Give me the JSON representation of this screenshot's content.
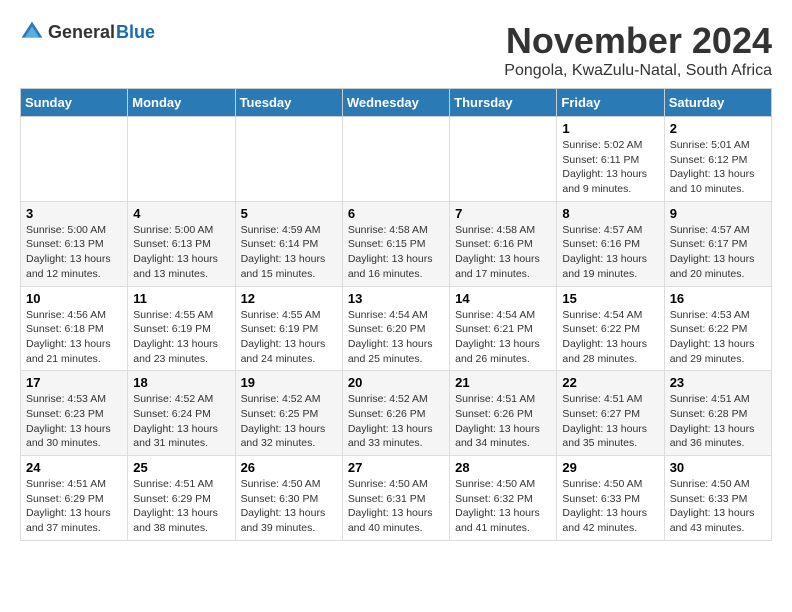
{
  "logo": {
    "general": "General",
    "blue": "Blue"
  },
  "title": "November 2024",
  "subtitle": "Pongola, KwaZulu-Natal, South Africa",
  "headers": [
    "Sunday",
    "Monday",
    "Tuesday",
    "Wednesday",
    "Thursday",
    "Friday",
    "Saturday"
  ],
  "rows": [
    [
      {
        "day": "",
        "detail": ""
      },
      {
        "day": "",
        "detail": ""
      },
      {
        "day": "",
        "detail": ""
      },
      {
        "day": "",
        "detail": ""
      },
      {
        "day": "",
        "detail": ""
      },
      {
        "day": "1",
        "detail": "Sunrise: 5:02 AM\nSunset: 6:11 PM\nDaylight: 13 hours\nand 9 minutes."
      },
      {
        "day": "2",
        "detail": "Sunrise: 5:01 AM\nSunset: 6:12 PM\nDaylight: 13 hours\nand 10 minutes."
      }
    ],
    [
      {
        "day": "3",
        "detail": "Sunrise: 5:00 AM\nSunset: 6:13 PM\nDaylight: 13 hours\nand 12 minutes."
      },
      {
        "day": "4",
        "detail": "Sunrise: 5:00 AM\nSunset: 6:13 PM\nDaylight: 13 hours\nand 13 minutes."
      },
      {
        "day": "5",
        "detail": "Sunrise: 4:59 AM\nSunset: 6:14 PM\nDaylight: 13 hours\nand 15 minutes."
      },
      {
        "day": "6",
        "detail": "Sunrise: 4:58 AM\nSunset: 6:15 PM\nDaylight: 13 hours\nand 16 minutes."
      },
      {
        "day": "7",
        "detail": "Sunrise: 4:58 AM\nSunset: 6:16 PM\nDaylight: 13 hours\nand 17 minutes."
      },
      {
        "day": "8",
        "detail": "Sunrise: 4:57 AM\nSunset: 6:16 PM\nDaylight: 13 hours\nand 19 minutes."
      },
      {
        "day": "9",
        "detail": "Sunrise: 4:57 AM\nSunset: 6:17 PM\nDaylight: 13 hours\nand 20 minutes."
      }
    ],
    [
      {
        "day": "10",
        "detail": "Sunrise: 4:56 AM\nSunset: 6:18 PM\nDaylight: 13 hours\nand 21 minutes."
      },
      {
        "day": "11",
        "detail": "Sunrise: 4:55 AM\nSunset: 6:19 PM\nDaylight: 13 hours\nand 23 minutes."
      },
      {
        "day": "12",
        "detail": "Sunrise: 4:55 AM\nSunset: 6:19 PM\nDaylight: 13 hours\nand 24 minutes."
      },
      {
        "day": "13",
        "detail": "Sunrise: 4:54 AM\nSunset: 6:20 PM\nDaylight: 13 hours\nand 25 minutes."
      },
      {
        "day": "14",
        "detail": "Sunrise: 4:54 AM\nSunset: 6:21 PM\nDaylight: 13 hours\nand 26 minutes."
      },
      {
        "day": "15",
        "detail": "Sunrise: 4:54 AM\nSunset: 6:22 PM\nDaylight: 13 hours\nand 28 minutes."
      },
      {
        "day": "16",
        "detail": "Sunrise: 4:53 AM\nSunset: 6:22 PM\nDaylight: 13 hours\nand 29 minutes."
      }
    ],
    [
      {
        "day": "17",
        "detail": "Sunrise: 4:53 AM\nSunset: 6:23 PM\nDaylight: 13 hours\nand 30 minutes."
      },
      {
        "day": "18",
        "detail": "Sunrise: 4:52 AM\nSunset: 6:24 PM\nDaylight: 13 hours\nand 31 minutes."
      },
      {
        "day": "19",
        "detail": "Sunrise: 4:52 AM\nSunset: 6:25 PM\nDaylight: 13 hours\nand 32 minutes."
      },
      {
        "day": "20",
        "detail": "Sunrise: 4:52 AM\nSunset: 6:26 PM\nDaylight: 13 hours\nand 33 minutes."
      },
      {
        "day": "21",
        "detail": "Sunrise: 4:51 AM\nSunset: 6:26 PM\nDaylight: 13 hours\nand 34 minutes."
      },
      {
        "day": "22",
        "detail": "Sunrise: 4:51 AM\nSunset: 6:27 PM\nDaylight: 13 hours\nand 35 minutes."
      },
      {
        "day": "23",
        "detail": "Sunrise: 4:51 AM\nSunset: 6:28 PM\nDaylight: 13 hours\nand 36 minutes."
      }
    ],
    [
      {
        "day": "24",
        "detail": "Sunrise: 4:51 AM\nSunset: 6:29 PM\nDaylight: 13 hours\nand 37 minutes."
      },
      {
        "day": "25",
        "detail": "Sunrise: 4:51 AM\nSunset: 6:29 PM\nDaylight: 13 hours\nand 38 minutes."
      },
      {
        "day": "26",
        "detail": "Sunrise: 4:50 AM\nSunset: 6:30 PM\nDaylight: 13 hours\nand 39 minutes."
      },
      {
        "day": "27",
        "detail": "Sunrise: 4:50 AM\nSunset: 6:31 PM\nDaylight: 13 hours\nand 40 minutes."
      },
      {
        "day": "28",
        "detail": "Sunrise: 4:50 AM\nSunset: 6:32 PM\nDaylight: 13 hours\nand 41 minutes."
      },
      {
        "day": "29",
        "detail": "Sunrise: 4:50 AM\nSunset: 6:33 PM\nDaylight: 13 hours\nand 42 minutes."
      },
      {
        "day": "30",
        "detail": "Sunrise: 4:50 AM\nSunset: 6:33 PM\nDaylight: 13 hours\nand 43 minutes."
      }
    ]
  ]
}
